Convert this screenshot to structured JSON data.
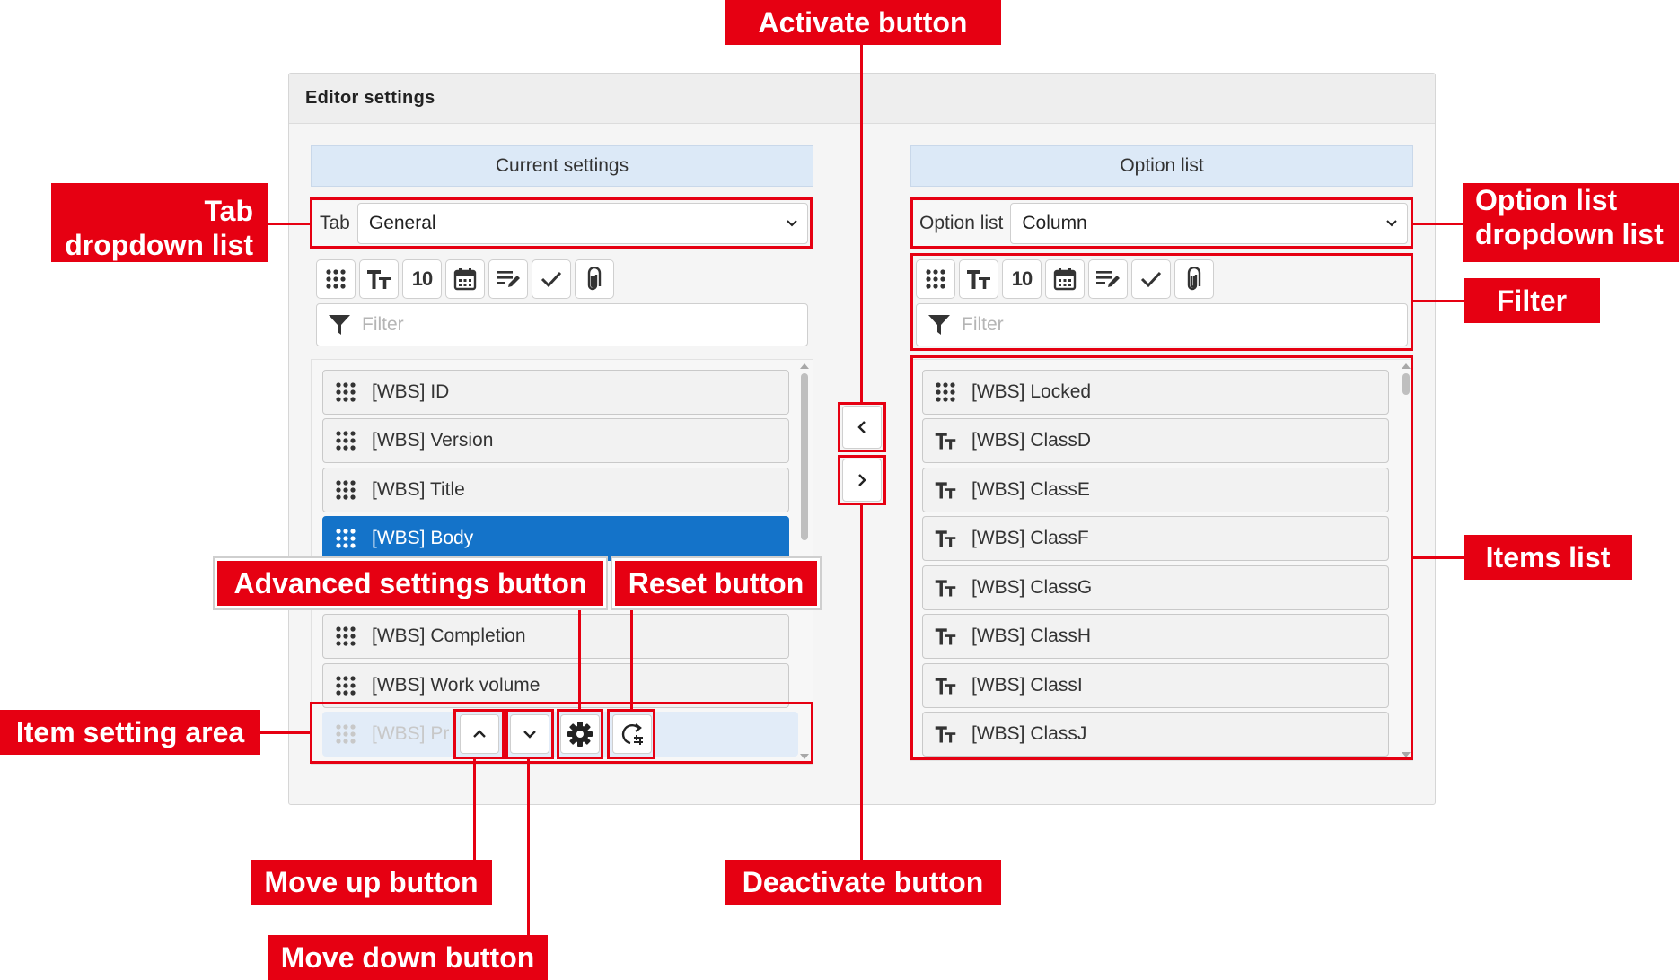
{
  "panel": {
    "title": "Editor settings"
  },
  "current": {
    "header": "Current settings",
    "tab_label": "Tab",
    "tab_value": "General",
    "filter_placeholder": "Filter",
    "items": [
      {
        "label": "[WBS] ID",
        "icon": "drag-dots-icon",
        "state": "normal"
      },
      {
        "label": "[WBS] Version",
        "icon": "drag-dots-icon",
        "state": "normal"
      },
      {
        "label": "[WBS] Title",
        "icon": "drag-dots-icon",
        "state": "normal"
      },
      {
        "label": "[WBS] Body",
        "icon": "drag-dots-icon",
        "state": "selected"
      },
      {
        "label": "[WBS] Completion",
        "icon": "drag-dots-icon",
        "state": "normal"
      },
      {
        "label": "[WBS] Work volume",
        "icon": "drag-dots-icon",
        "state": "normal"
      },
      {
        "label": "[WBS] Pr",
        "icon": "drag-dots-icon",
        "state": "ghost"
      }
    ]
  },
  "options": {
    "header": "Option list",
    "select_label": "Option list",
    "select_value": "Column",
    "filter_placeholder": "Filter",
    "items": [
      {
        "label": "[WBS] Locked",
        "icon": "drag-dots-icon"
      },
      {
        "label": "[WBS] ClassD",
        "icon": "text-type-icon"
      },
      {
        "label": "[WBS] ClassE",
        "icon": "text-type-icon"
      },
      {
        "label": "[WBS] ClassF",
        "icon": "text-type-icon"
      },
      {
        "label": "[WBS] ClassG",
        "icon": "text-type-icon"
      },
      {
        "label": "[WBS] ClassH",
        "icon": "text-type-icon"
      },
      {
        "label": "[WBS] ClassI",
        "icon": "text-type-icon"
      },
      {
        "label": "[WBS] ClassJ",
        "icon": "text-type-icon"
      }
    ]
  },
  "toolbar_icons": [
    "drag-dots-icon",
    "text-type-icon",
    "number-icon",
    "calendar-icon",
    "edit-lines-icon",
    "check-icon",
    "paperclip-icon"
  ],
  "toolbar_number_text": "10",
  "annotations": {
    "activate": "Activate button",
    "tab_dropdown_line1": "Tab",
    "tab_dropdown_line2": "dropdown list",
    "option_dropdown_line1": "Option list",
    "option_dropdown_line2": "dropdown list",
    "filter": "Filter",
    "items_list": "Items list",
    "advanced": "Advanced settings button",
    "reset": "Reset button",
    "item_setting_area": "Item setting area",
    "move_up": "Move up button",
    "move_down": "Move down button",
    "deactivate": "Deactivate button"
  },
  "colors": {
    "accent_red": "#e60012",
    "selected_blue": "#1473c9",
    "header_blue": "#dce9f7"
  }
}
